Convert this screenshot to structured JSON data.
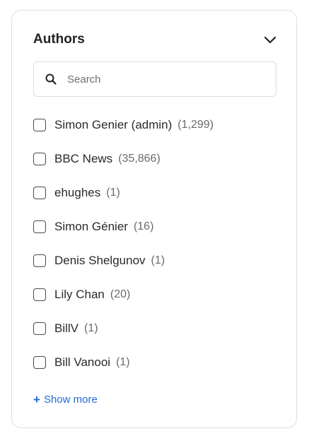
{
  "filter": {
    "title": "Authors",
    "search": {
      "placeholder": "Search",
      "value": ""
    },
    "items": [
      {
        "label": "Simon Genier (admin)",
        "count": "(1,299)",
        "checked": false
      },
      {
        "label": "BBC News",
        "count": "(35,866)",
        "checked": false
      },
      {
        "label": "ehughes",
        "count": "(1)",
        "checked": false
      },
      {
        "label": "Simon Génier",
        "count": "(16)",
        "checked": false
      },
      {
        "label": "Denis Shelgunov",
        "count": "(1)",
        "checked": false
      },
      {
        "label": "Lily Chan",
        "count": "(20)",
        "checked": false
      },
      {
        "label": "BillV",
        "count": "(1)",
        "checked": false
      },
      {
        "label": "Bill Vanooi",
        "count": "(1)",
        "checked": false
      }
    ],
    "show_more": {
      "plus": "+",
      "label": "Show more"
    },
    "icons": {
      "collapse": "chevron-up-icon",
      "search": "search-icon",
      "show_more": "plus-icon"
    },
    "colors": {
      "link": "#1f6bd6",
      "border": "#dedede",
      "text": "#222222",
      "muted": "#6b6b6b"
    }
  }
}
